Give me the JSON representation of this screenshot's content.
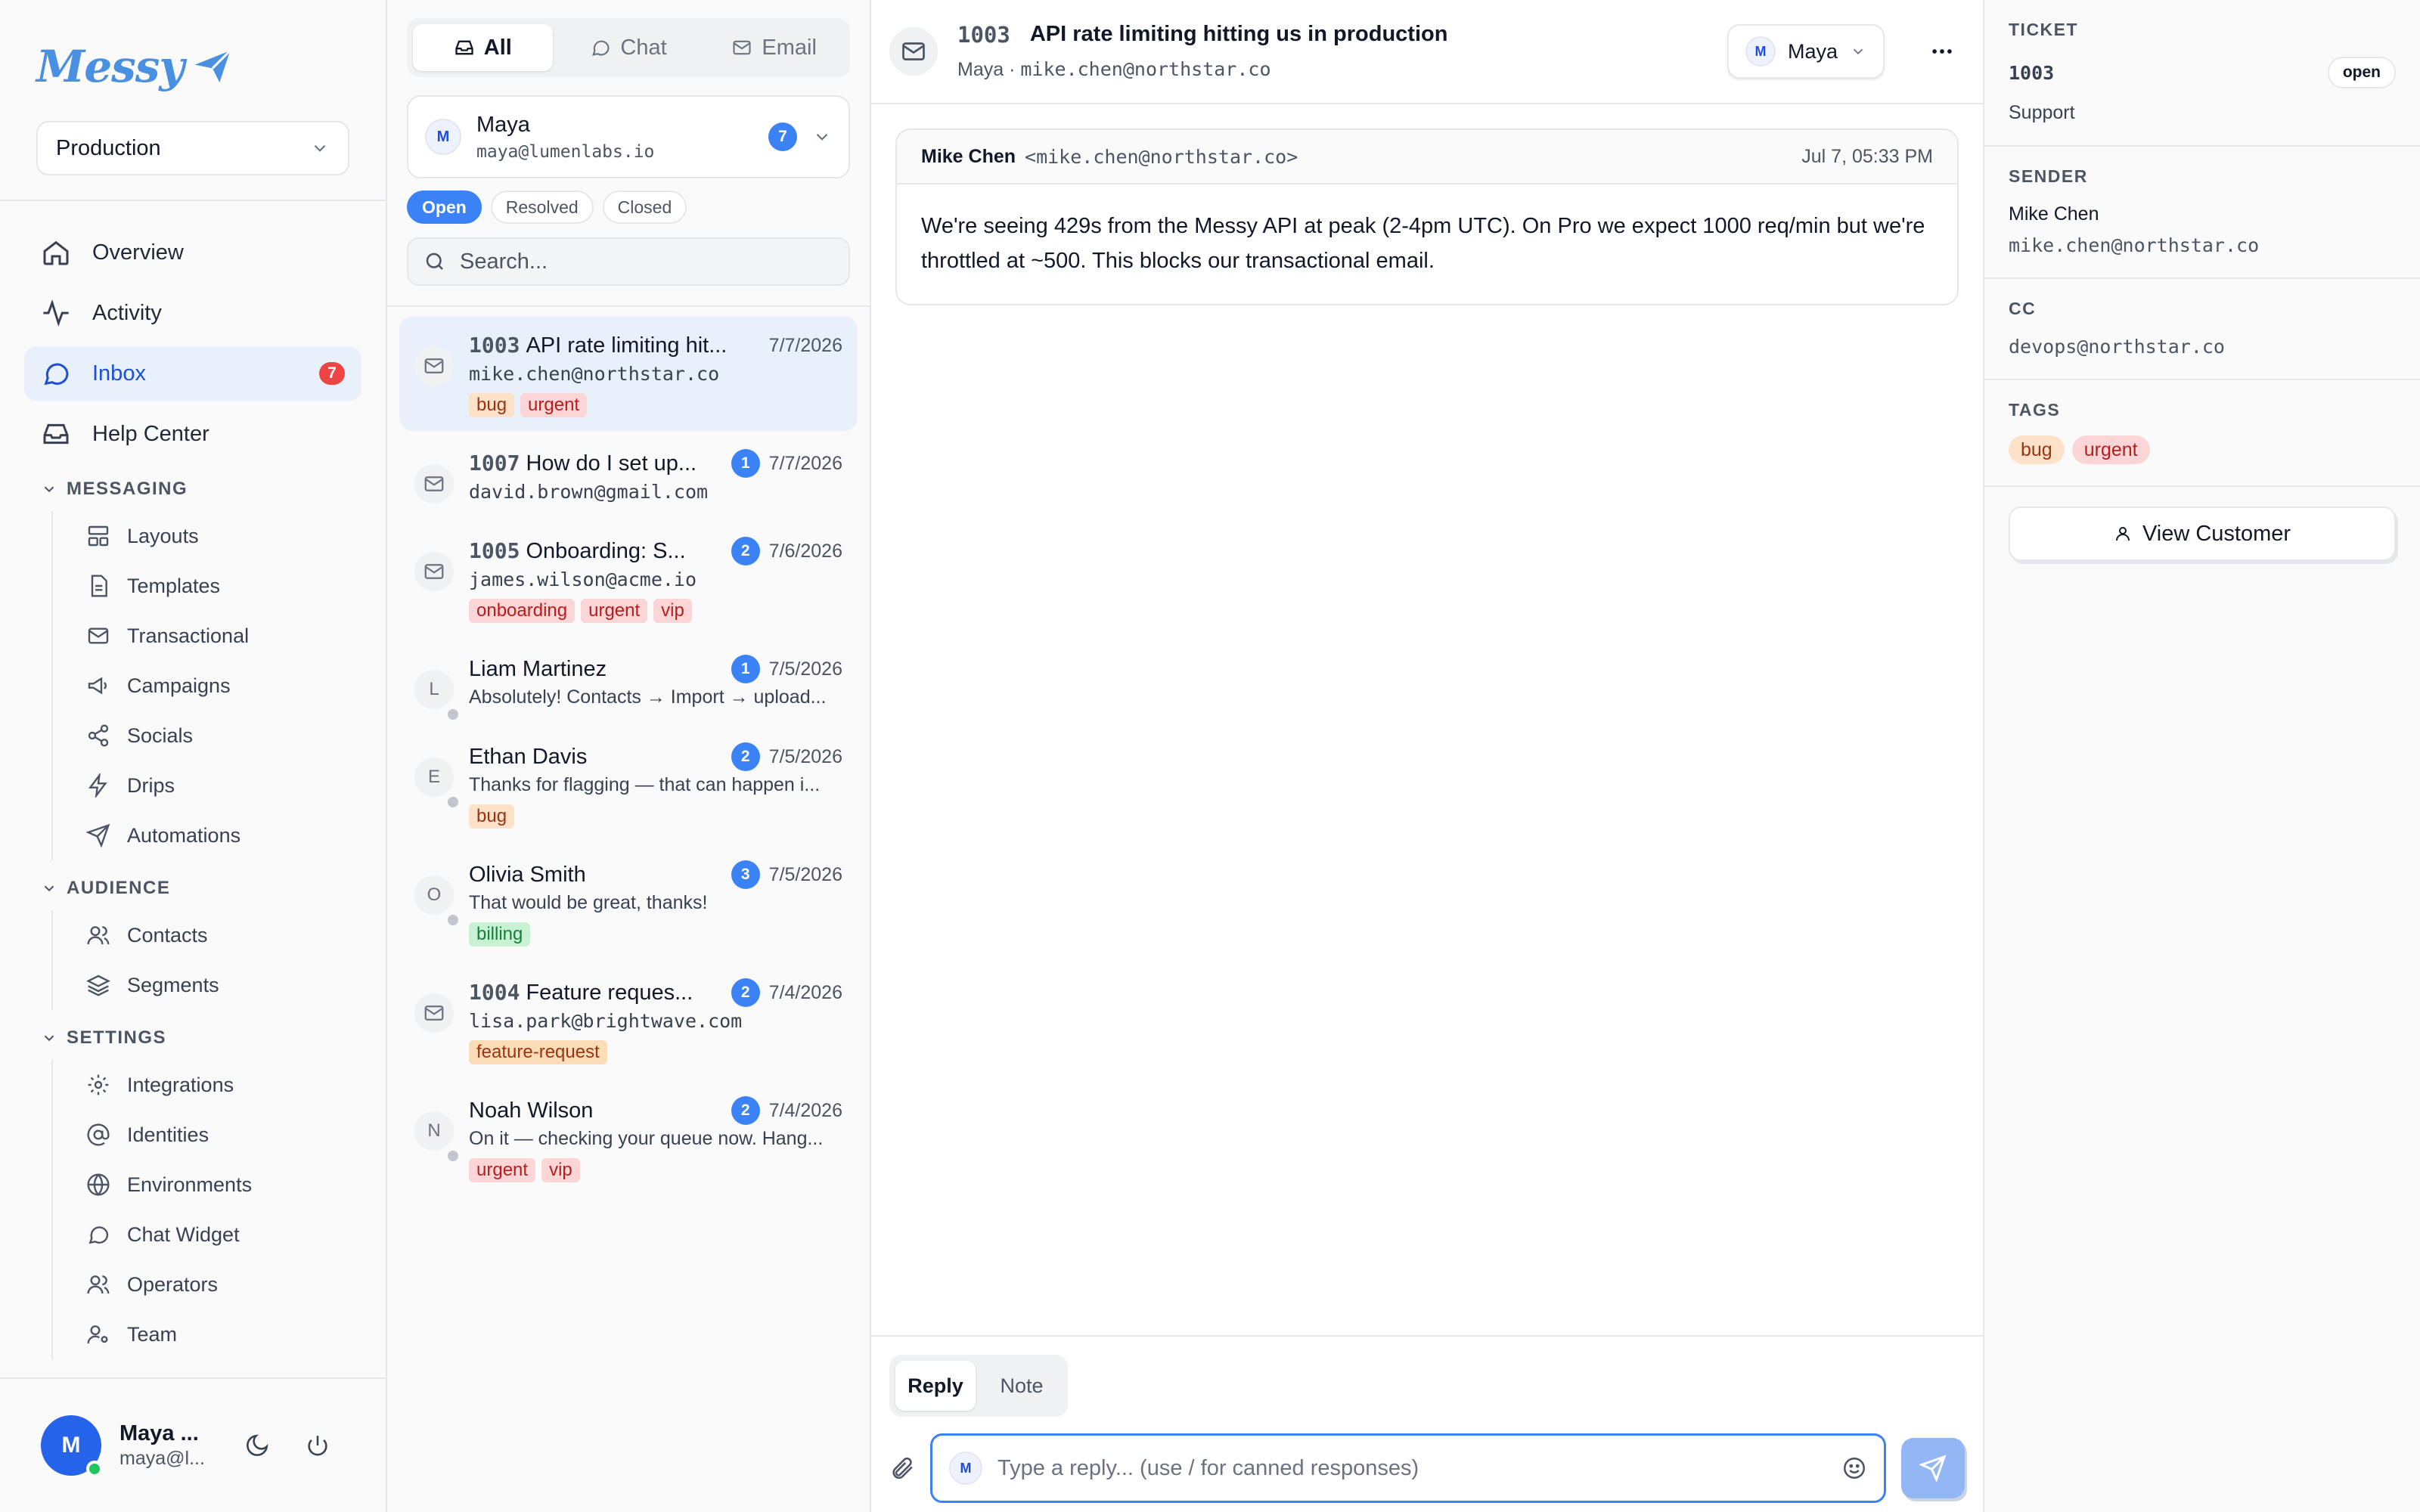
{
  "brand": {
    "name": "Messy"
  },
  "sidebar": {
    "environment": "Production",
    "nav": [
      {
        "label": "Overview",
        "icon": "home-icon"
      },
      {
        "label": "Activity",
        "icon": "activity-icon"
      },
      {
        "label": "Inbox",
        "icon": "chat-bubble-icon",
        "badge": "7",
        "active": true
      },
      {
        "label": "Help Center",
        "icon": "inbox-tray-icon"
      }
    ],
    "sections": {
      "messaging": {
        "title": "MESSAGING",
        "items": [
          "Layouts",
          "Templates",
          "Transactional",
          "Campaigns",
          "Socials",
          "Drips",
          "Automations"
        ]
      },
      "audience": {
        "title": "AUDIENCE",
        "items": [
          "Contacts",
          "Segments"
        ]
      },
      "settings": {
        "title": "SETTINGS",
        "items": [
          "Integrations",
          "Identities",
          "Environments",
          "Chat Widget",
          "Operators",
          "Team"
        ]
      }
    },
    "user": {
      "initial": "M",
      "name": "Maya ...",
      "email": "maya@l..."
    }
  },
  "listpane": {
    "channels": [
      "All",
      "Chat",
      "Email"
    ],
    "assignee": {
      "initial": "M",
      "name": "Maya",
      "email": "maya@lumenlabs.io",
      "count": "7"
    },
    "statuses": [
      "Open",
      "Resolved",
      "Closed"
    ],
    "search_placeholder": "Search...",
    "conversations": [
      {
        "type": "email",
        "id": "1003",
        "title": "API rate limiting hit...",
        "date": "7/7/2026",
        "sub": "mike.chen@northstar.co",
        "mono": true,
        "tags": [
          "bug",
          "urgent"
        ],
        "active": true
      },
      {
        "type": "email",
        "id": "1007",
        "title": "How do I set up...",
        "date": "7/7/2026",
        "sub": "david.brown@gmail.com",
        "mono": true,
        "count": "1",
        "tags": []
      },
      {
        "type": "email",
        "id": "1005",
        "title": "Onboarding: S...",
        "date": "7/6/2026",
        "sub": "james.wilson@acme.io",
        "mono": true,
        "count": "2",
        "tags": [
          "onboarding",
          "urgent",
          "vip"
        ]
      },
      {
        "type": "chat",
        "initial": "L",
        "title": "Liam Martinez",
        "date": "7/5/2026",
        "sub": "Absolutely! Contacts → Import → upload...",
        "count": "1",
        "tags": []
      },
      {
        "type": "chat",
        "initial": "E",
        "title": "Ethan Davis",
        "date": "7/5/2026",
        "sub": "Thanks for flagging — that can happen i...",
        "count": "2",
        "tags": [
          "bug"
        ]
      },
      {
        "type": "chat",
        "initial": "O",
        "title": "Olivia Smith",
        "date": "7/5/2026",
        "sub": "That would be great, thanks!",
        "count": "3",
        "tags": [
          "billing"
        ]
      },
      {
        "type": "email",
        "id": "1004",
        "title": "Feature reques...",
        "date": "7/4/2026",
        "sub": "lisa.park@brightwave.com",
        "mono": true,
        "count": "2",
        "tags": [
          "feature-request"
        ]
      },
      {
        "type": "chat",
        "initial": "N",
        "title": "Noah Wilson",
        "date": "7/4/2026",
        "sub": "On it — checking your queue now. Hang...",
        "count": "2",
        "tags": [
          "urgent",
          "vip"
        ]
      }
    ]
  },
  "main": {
    "ticket_id": "1003",
    "title": "API rate limiting hitting us in production",
    "assignee_label": "Maya",
    "requester": "mike.chen@northstar.co",
    "assign_button": {
      "initial": "M",
      "label": "Maya"
    },
    "message": {
      "from": "Mike Chen",
      "addr": "<mike.chen@northstar.co>",
      "date": "Jul 7, 05:33 PM",
      "body": "We're seeing 429s from the Messy API at peak (2-4pm UTC). On Pro we expect 1000 req/min but we're throttled at ~500. This blocks our transactional email."
    },
    "composer": {
      "tabs": [
        "Reply",
        "Note"
      ],
      "initial": "M",
      "placeholder": "Type a reply... (use / for canned responses)"
    }
  },
  "details": {
    "ticket_label": "TICKET",
    "ticket_id": "1003",
    "status": "open",
    "queue": "Support",
    "sender_label": "SENDER",
    "sender_name": "Mike Chen",
    "sender_email": "mike.chen@northstar.co",
    "cc_label": "CC",
    "cc": "devops@northstar.co",
    "tags_label": "TAGS",
    "tags": [
      "bug",
      "urgent"
    ],
    "view_customer": "View Customer"
  },
  "colors": {
    "accent": "#3b82f6",
    "brand": "#4a90e2",
    "danger": "#ef4444"
  }
}
